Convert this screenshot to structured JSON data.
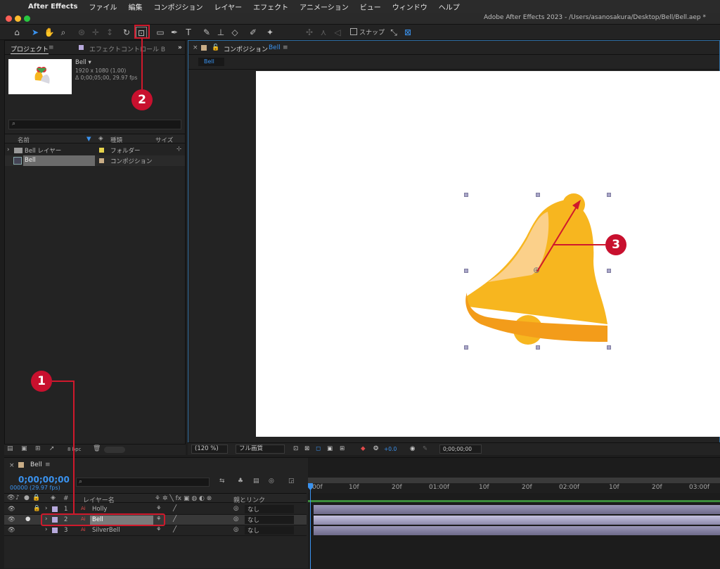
{
  "menubar": {
    "app": "After Effects",
    "items": [
      "ファイル",
      "編集",
      "コンポジション",
      "レイヤー",
      "エフェクト",
      "アニメーション",
      "ビュー",
      "ウィンドウ",
      "ヘルプ"
    ]
  },
  "window": {
    "title": "Adobe After Effects 2023 - /Users/asanosakura/Desktop/Bell/Bell.aep *"
  },
  "toolbar": {
    "snap_label": "スナップ"
  },
  "project": {
    "tab": "プロジェクト",
    "effect_tab": "エフェクトコントロール B",
    "comp_name": "Bell ▾",
    "resolution": "1920 x 1080 (1.00)",
    "duration": "Δ 0;00;05;00, 29.97 fps",
    "columns": {
      "name": "名前",
      "kind": "種類",
      "size": "サイズ"
    },
    "items": [
      {
        "name": "Bell レイヤー",
        "kind": "フォルダー",
        "color": "#e6d24a"
      },
      {
        "name": "Bell",
        "kind": "コンポジション",
        "color": "#c9ad86"
      }
    ],
    "bpc": "8 bpc"
  },
  "comp": {
    "tab_close": "×",
    "tab_label": "コンポジション",
    "tab_name": "Bell",
    "sub_tab": "Bell",
    "zoom": "(120 %)",
    "quality": "フル画質",
    "exposure": "+0.0",
    "timecode": "0;00;00;00"
  },
  "timeline": {
    "tab": "Bell",
    "timecode": "0;00;00;00",
    "frames": "00000 (29.97 fps)",
    "layer_name_header": "レイヤー名",
    "parent_header": "親とリンク",
    "ruler": [
      "00f",
      "10f",
      "20f",
      "01:00f",
      "10f",
      "20f",
      "02:00f",
      "10f",
      "20f",
      "03:00f"
    ],
    "layers": [
      {
        "num": "1",
        "name": "Holly",
        "parent": "なし"
      },
      {
        "num": "2",
        "name": "Bell",
        "parent": "なし"
      },
      {
        "num": "3",
        "name": "SilverBell",
        "parent": "なし"
      }
    ]
  },
  "annotations": [
    "1",
    "2",
    "3"
  ],
  "colors": {
    "accent": "#2d8ceb",
    "annotation": "#c8102e",
    "bell": "#f7b61f"
  }
}
